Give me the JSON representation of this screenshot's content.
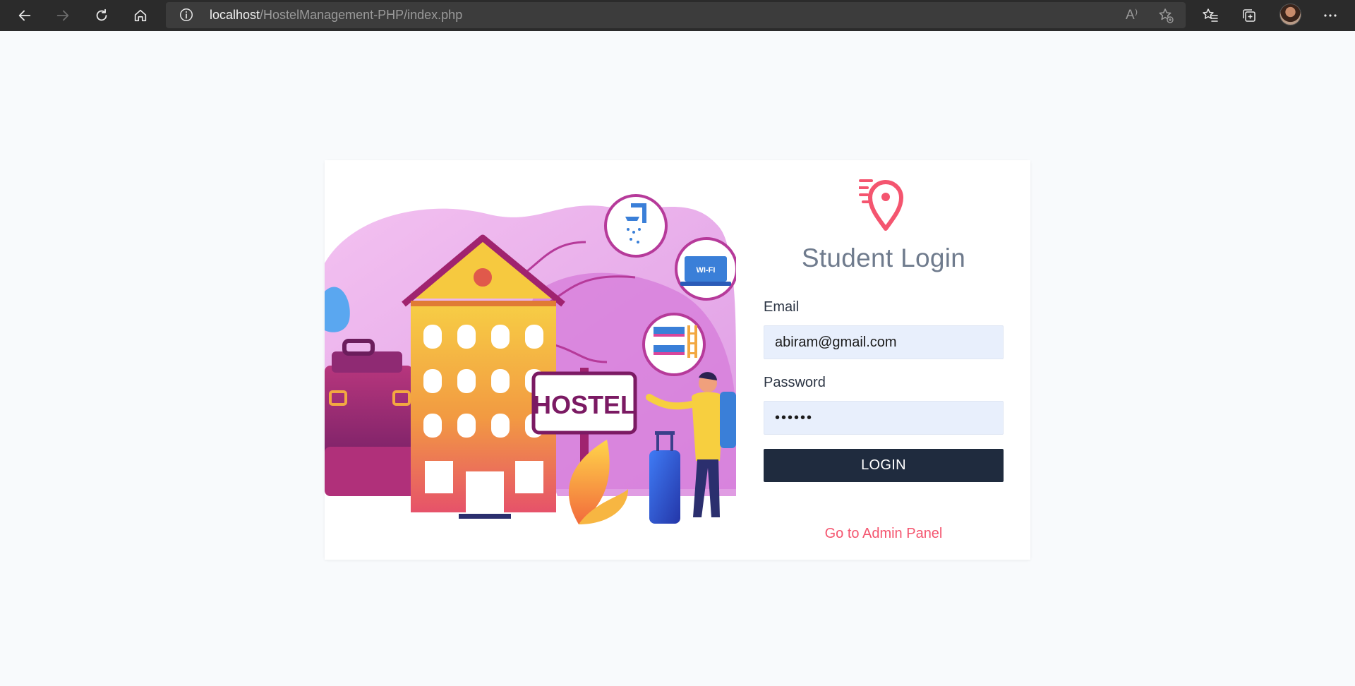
{
  "browser": {
    "url_host": "localhost",
    "url_path": "/HostelManagement-PHP/index.php",
    "read_aloud_label": "A⁾"
  },
  "illustration": {
    "sign_text": "HOSTEL",
    "wifi_text": "WI-FI"
  },
  "login": {
    "title": "Student Login",
    "email_label": "Email",
    "email_value": "abiram@gmail.com",
    "password_label": "Password",
    "password_value": "••••••",
    "login_button": "LOGIN",
    "admin_link": "Go to Admin Panel"
  },
  "colors": {
    "accent": "#f4556f",
    "button_bg": "#1f2b3e",
    "input_bg": "#e8effc",
    "title": "#6f7b8d",
    "chrome_bg": "#2b2b2b"
  },
  "icons": {
    "back": "back-arrow-icon",
    "forward": "forward-arrow-icon",
    "refresh": "refresh-icon",
    "home": "home-icon",
    "site_info": "info-icon",
    "read_aloud": "read-aloud-icon",
    "add_favorite": "add-favorite-icon",
    "favorites": "favorites-icon",
    "collections": "collections-icon",
    "menu": "more-menu-icon",
    "logo": "location-pin-icon"
  }
}
